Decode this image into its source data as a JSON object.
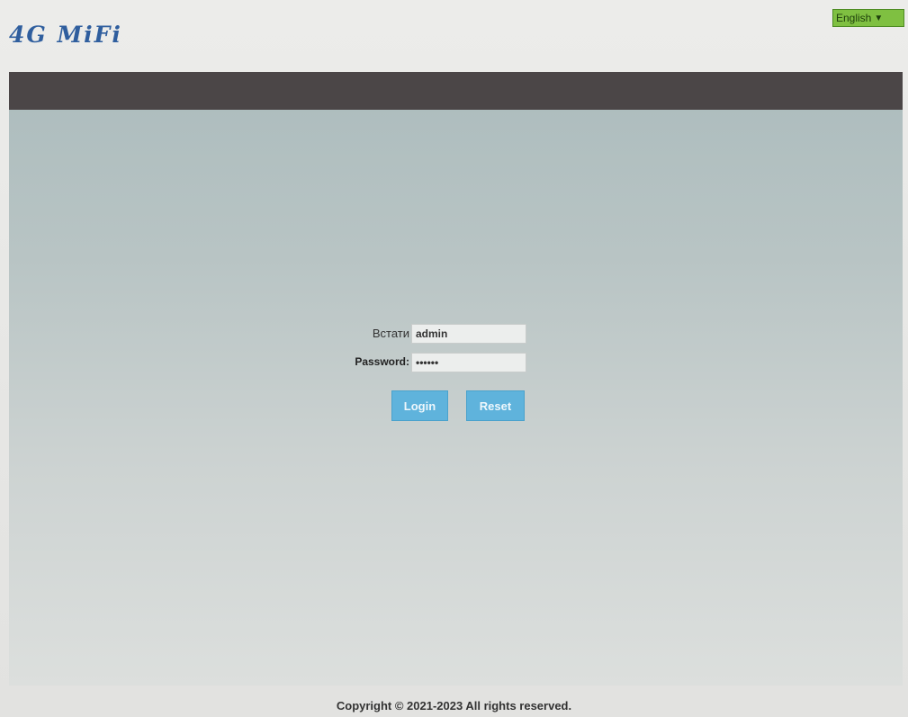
{
  "header": {
    "logo_text": "4G MiFi",
    "language": {
      "selected": "English",
      "chevron_icon": "chevron-down-icon"
    }
  },
  "login": {
    "username_label": "Встати",
    "username_value": "admin",
    "password_label": "Password:",
    "password_value": "••••••",
    "login_button": "Login",
    "reset_button": "Reset"
  },
  "footer": {
    "copyright": "Copyright © 2021-2023 All rights reserved."
  },
  "colors": {
    "logo": "#2f5e9e",
    "top_bar": "#4b4647",
    "button": "#5fb3dc",
    "language_select": "#7fc041"
  }
}
